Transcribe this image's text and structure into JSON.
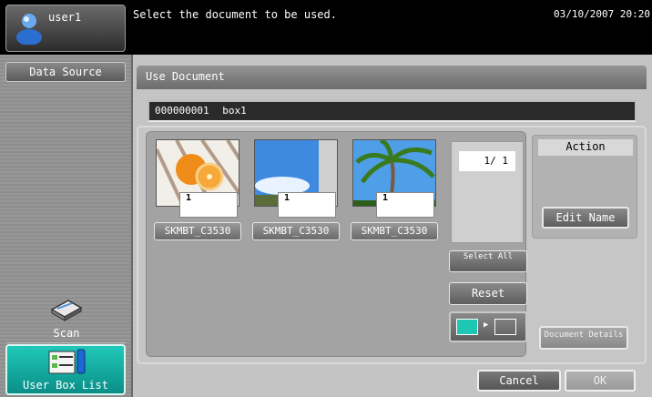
{
  "header": {
    "user_name": "user1",
    "message": "Select the document to be used.",
    "datetime": "03/10/2007 20:20"
  },
  "sidebar": {
    "data_source_label": "Data Source",
    "scan_label": "Scan",
    "user_box_list_label": "User Box List"
  },
  "main": {
    "tab_title": "Use Document",
    "box": {
      "number": "000000001",
      "name": "box1"
    },
    "documents": [
      {
        "name": "SKMBT_C3530",
        "copies": "1",
        "thumbnail": "orange-slices"
      },
      {
        "name": "SKMBT_C3530",
        "copies": "1",
        "thumbnail": "blue-sky"
      },
      {
        "name": "SKMBT_C3530",
        "copies": "1",
        "thumbnail": "palm-tree"
      }
    ],
    "page_indicator": "1/  1",
    "select_all_label": "Select All",
    "reset_label": "Reset",
    "view_toggle": {
      "icons": [
        "thumbnail-view-icon",
        "list-view-icon"
      ],
      "selected": "thumbnail"
    },
    "action": {
      "title": "Action",
      "edit_name_label": "Edit Name",
      "document_details_label": "Document Details"
    }
  },
  "footer": {
    "cancel_label": "Cancel",
    "ok_label": "OK"
  },
  "colors": {
    "header_bg": "#000000",
    "accent_teal": "#1ec6b4",
    "panel_gray": "#a3a3a3"
  }
}
